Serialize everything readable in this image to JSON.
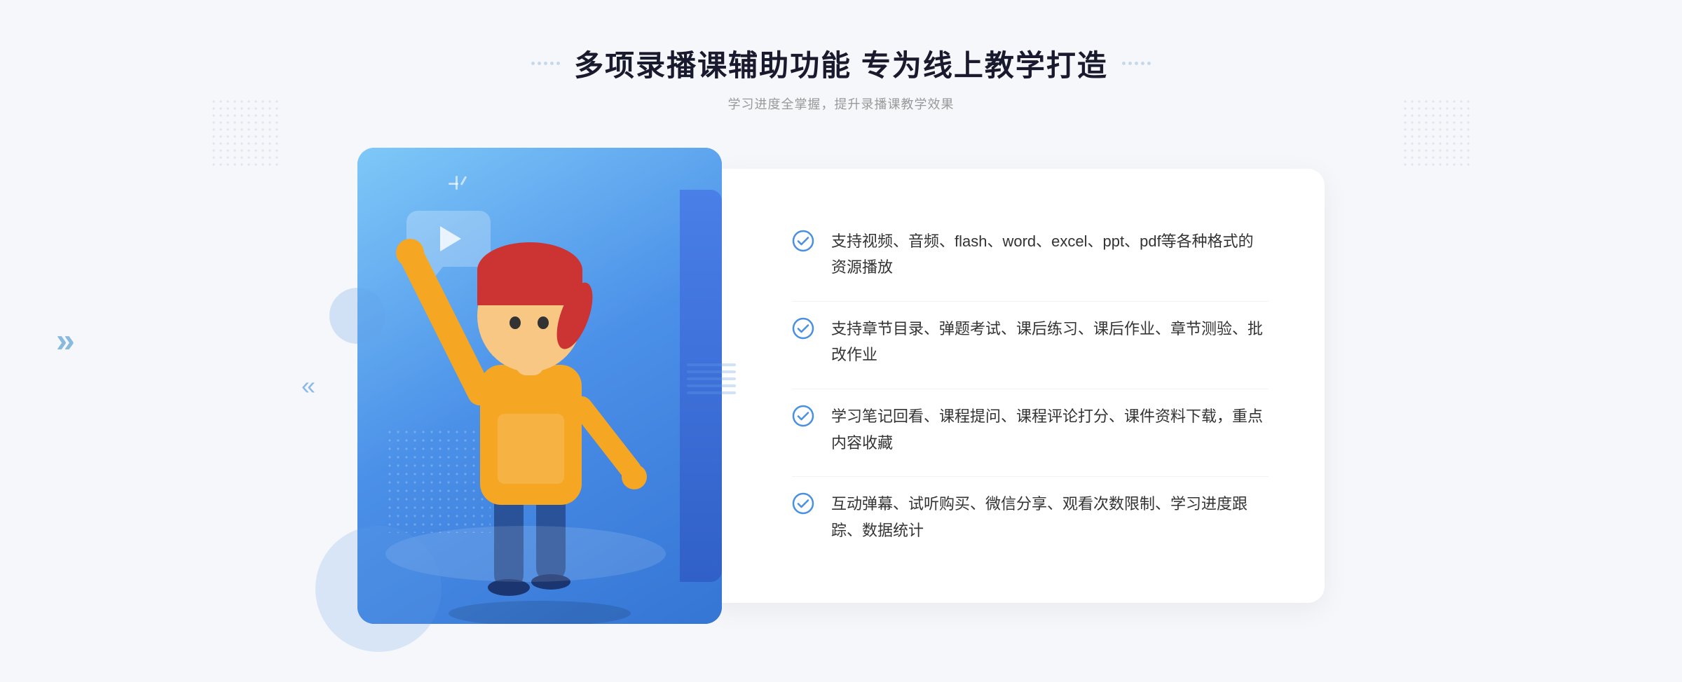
{
  "page": {
    "background_color": "#f5f7fa"
  },
  "header": {
    "title": "多项录播课辅助功能 专为线上教学打造",
    "subtitle": "学习进度全掌握，提升录播课教学效果",
    "decorator_dots_count": 5
  },
  "features": [
    {
      "id": 1,
      "text": "支持视频、音频、flash、word、excel、ppt、pdf等各种格式的资源播放"
    },
    {
      "id": 2,
      "text": "支持章节目录、弹题考试、课后练习、课后作业、章节测验、批改作业"
    },
    {
      "id": 3,
      "text": "学习笔记回看、课程提问、课程评论打分、课件资料下载，重点内容收藏"
    },
    {
      "id": 4,
      "text": "互动弹幕、试听购买、微信分享、观看次数限制、学习进度跟踪、数据统计"
    }
  ],
  "icons": {
    "check_color": "#4a90e2",
    "play_color": "rgba(255,255,255,0.8)",
    "chevron_symbol": "»"
  }
}
